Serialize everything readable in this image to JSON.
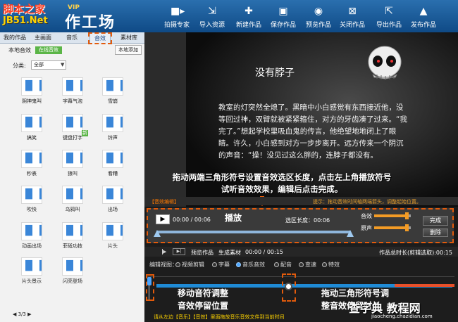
{
  "watermark": {
    "site_cn": "脚本之家",
    "site_url": "JB51.Net",
    "bottom_cn": "查字典 教程网",
    "bottom_url": "jiaocheng.chazidian.com"
  },
  "app": {
    "vip": "VIP",
    "name": "作工场"
  },
  "toolbar": {
    "items": [
      {
        "label": "拍摄专家",
        "icon": "camera-icon"
      },
      {
        "label": "导入资源",
        "icon": "import-icon"
      },
      {
        "label": "新建作品",
        "icon": "new-file-icon"
      },
      {
        "label": "保存作品",
        "icon": "save-icon"
      },
      {
        "label": "预览作品",
        "icon": "eye-icon"
      },
      {
        "label": "关闭作品",
        "icon": "close-icon"
      },
      {
        "label": "导出作品",
        "icon": "export-icon"
      },
      {
        "label": "发布作品",
        "icon": "publish-icon"
      }
    ]
  },
  "left_tabs": [
    "我的作品",
    "主画面",
    "音乐",
    "音效",
    "素材库"
  ],
  "sfx": {
    "local_label": "本地音效",
    "online_label": "在线音效",
    "add_local": "本地添加",
    "category_label": "分类:",
    "category_value": "全部",
    "items": [
      "阴神鬼叫",
      "字幕气泡",
      "雪崩",
      "搞笑",
      "键盘打字",
      "铃声",
      "秒表",
      "狼叫",
      "看糟",
      "吹快",
      "乌鸦叫",
      "出场",
      "动画出场",
      "菲砥功技",
      "片头",
      "片头景示",
      "闪亮登场"
    ],
    "new_badge": "新",
    "pager": "◀ 3/3 ▶"
  },
  "preview": {
    "title": "没有脖子",
    "body": "教室的灯突然全熄了。黑暗中小白感觉有东西接近他，没等回过神，双臂就被紧紧箍住，对方的牙齿凑了过来。“我完了。”想起学校里吸血鬼的传言，他绝望地地闭上了眼睛。许久，小白感到对方一步步离开。远方传来一个阴沉的声音：“操！没见过这么胖的，连脖子都没有。"
  },
  "annotations": {
    "top": "拖动两端三角形符号设置音效选区长度，点击左上角播放符号试听音效效果，编辑后点击完成。",
    "play": "播放",
    "move": "移动音符调整\n音效停留位置",
    "triangle": "拖动三角形符号调\n整音效停留时长"
  },
  "editor": {
    "title": "【音效编辑】",
    "tip": "提示：拖动音效时间轴两端箭头，调整起始位置。",
    "play_time": "00:00 / 00:06",
    "selection": "选区长度：00:06",
    "volume_label": "音效",
    "volume": 0.95,
    "echo_label": "原声",
    "echo": 0.95,
    "done": "完成",
    "delete": "删除"
  },
  "timeline": {
    "preview_label": "预览作品",
    "generate_label": "生成素材",
    "time": "00:00 / 00:15",
    "duration": "作品总时长(剪辑选取):00:15",
    "view_label": "编辑视图：",
    "views": [
      {
        "label": "视频剪辑",
        "on": false
      },
      {
        "label": "字幕",
        "on": false
      },
      {
        "label": "音乐音效",
        "on": true
      },
      {
        "label": "配音",
        "on": false
      },
      {
        "label": "变速",
        "on": false
      },
      {
        "label": "特效",
        "on": false
      }
    ],
    "hint": "请从左边【音乐】【音效】里面拖放音乐音效文件到当前时间"
  }
}
